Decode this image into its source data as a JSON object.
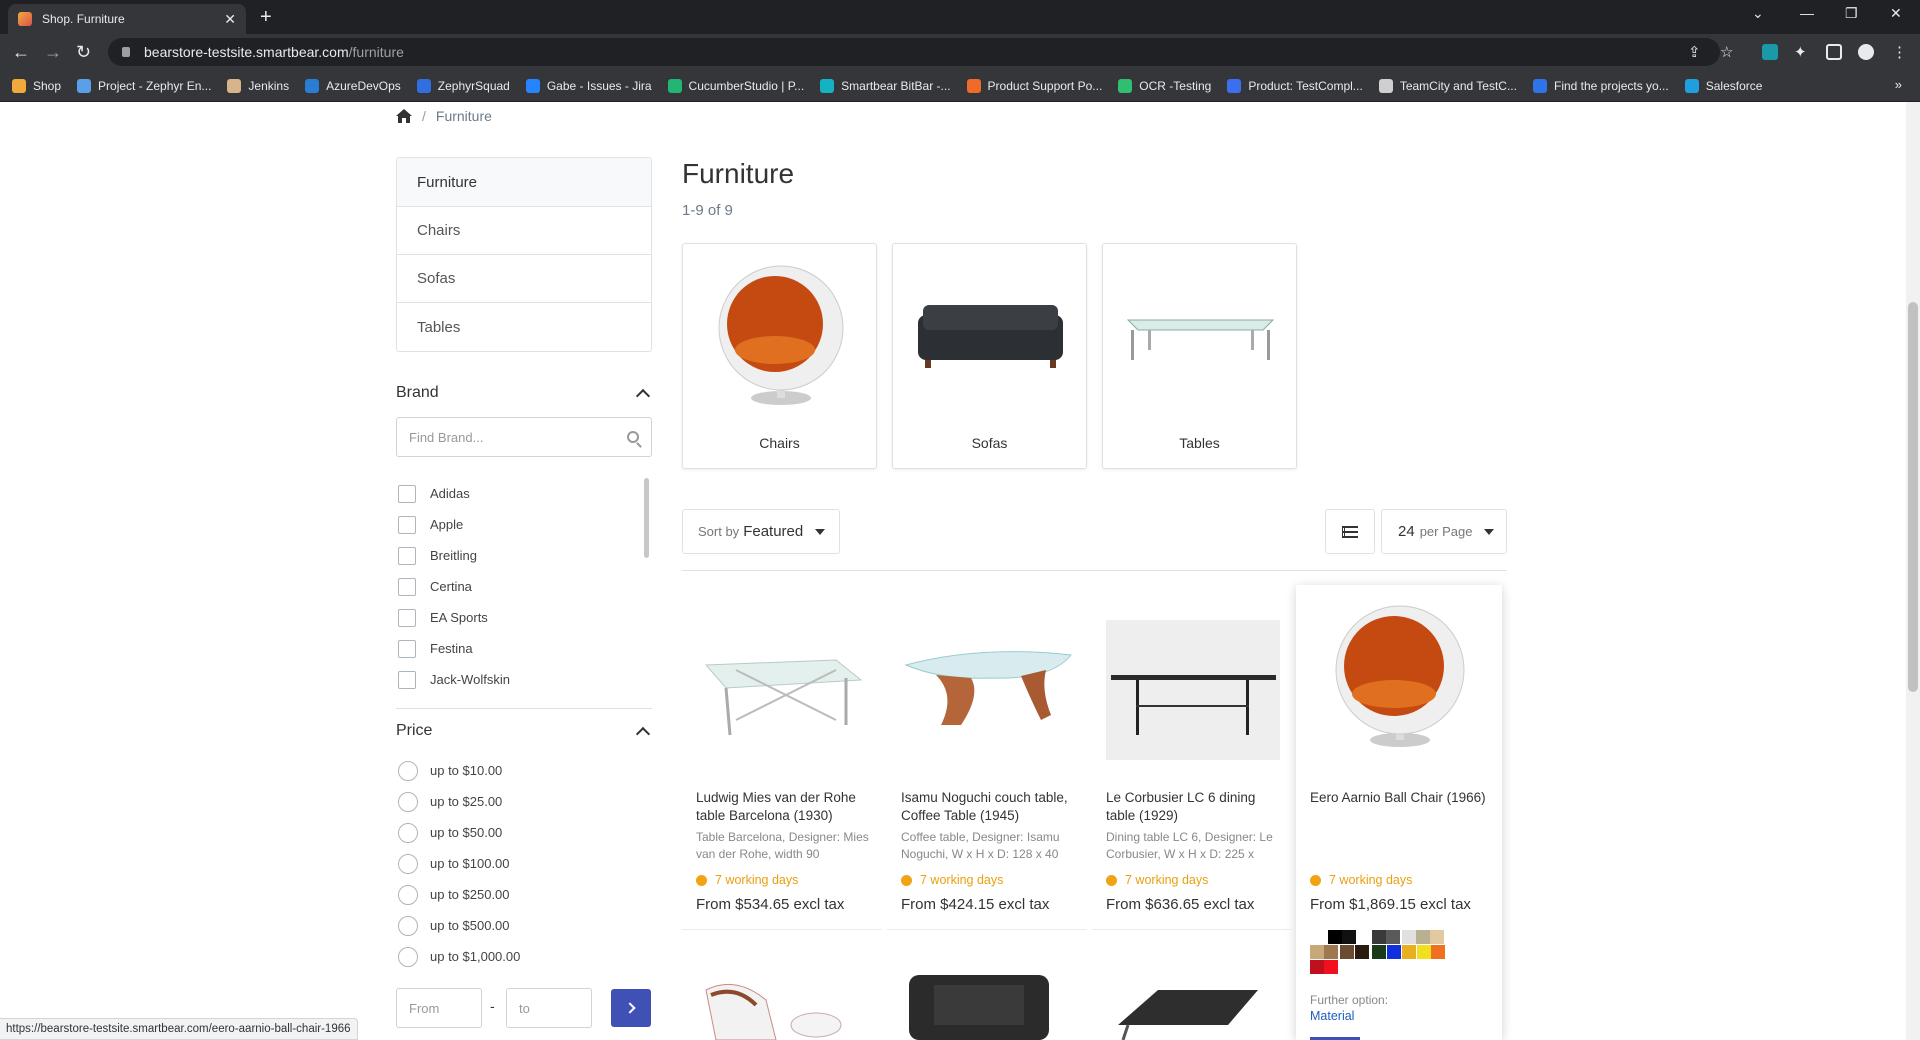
{
  "browser": {
    "tab_title": "Shop. Furniture",
    "url_host": "bearstore-testsite.smartbear.com",
    "url_path": "/furniture",
    "bookmarks": [
      {
        "label": "Shop",
        "color": "#f2a93b"
      },
      {
        "label": "Project - Zephyr En...",
        "color": "#5aa0e8"
      },
      {
        "label": "Jenkins",
        "color": "#d8b48a"
      },
      {
        "label": "AzureDevOps",
        "color": "#2b7cd3"
      },
      {
        "label": "ZephyrSquad",
        "color": "#2f6fdf"
      },
      {
        "label": "Gabe - Issues - Jira",
        "color": "#2684ff"
      },
      {
        "label": "CucumberStudio | P...",
        "color": "#22b573"
      },
      {
        "label": "Smartbear BitBar -...",
        "color": "#14b3c4"
      },
      {
        "label": "Product Support Po...",
        "color": "#f06a2a"
      },
      {
        "label": "OCR -Testing",
        "color": "#2fbf71"
      },
      {
        "label": "Product: TestCompl...",
        "color": "#3b6ff0"
      },
      {
        "label": "TeamCity and TestC...",
        "color": "#cfcfcf"
      },
      {
        "label": "Find the projects yo...",
        "color": "#2e74e8"
      },
      {
        "label": "Salesforce",
        "color": "#1f9ee0"
      }
    ],
    "bookmarks_more": "»",
    "status_url": "https://bearstore-testsite.smartbear.com/eero-aarnio-ball-chair-1966"
  },
  "breadcrumb": {
    "current": "Furniture",
    "separator": "/"
  },
  "sidebar": {
    "categories": [
      "Furniture",
      "Chairs",
      "Sofas",
      "Tables"
    ],
    "brand": {
      "title": "Brand",
      "search_placeholder": "Find Brand...",
      "options": [
        "Adidas",
        "Apple",
        "Breitling",
        "Certina",
        "EA Sports",
        "Festina",
        "Jack-Wolfskin"
      ]
    },
    "price": {
      "title": "Price",
      "options": [
        "up to $10.00",
        "up to $25.00",
        "up to $50.00",
        "up to $100.00",
        "up to $250.00",
        "up to $500.00",
        "up to $1,000.00"
      ],
      "from_placeholder": "From",
      "to_placeholder": "to",
      "dash": "-"
    }
  },
  "main": {
    "title": "Furniture",
    "count": "1-9 of 9",
    "subcategories": [
      "Chairs",
      "Sofas",
      "Tables"
    ],
    "sort": {
      "prefix": "Sort by",
      "value": "Featured"
    },
    "per_page": {
      "number": "24",
      "label": "per Page"
    },
    "products": [
      {
        "name": "Ludwig Mies van der Rohe table Barcelona (1930)",
        "desc": "Table Barcelona, Designer: Mies van der Rohe, width 90",
        "delivery": "7 working days",
        "price": "From $534.65 excl tax"
      },
      {
        "name": "Isamu Noguchi couch table, Coffee Table (1945)",
        "desc": "Coffee table, Designer: Isamu Noguchi, W x H x D: 128 x 40",
        "delivery": "7 working days",
        "price": "From $424.15 excl tax"
      },
      {
        "name": "Le Corbusier LC 6 dining table (1929)",
        "desc": "Dining table LC 6, Designer: Le Corbusier, W x H x D: 225 x",
        "delivery": "7 working days",
        "price": "From $636.65 excl tax"
      },
      {
        "name": "Eero Aarnio Ball Chair (1966)",
        "desc": "",
        "delivery": "7 working days",
        "price": "From $1,869.15 excl tax",
        "further_label": "Further option:",
        "further_link": "Material"
      }
    ],
    "swatch_colors": [
      "#000000",
      "#111111",
      "#ffffff",
      "#3a3a3a",
      "#5a5a5a",
      "#e0e0e0",
      "#b8b090",
      "#e2c9a0",
      "#c8a878",
      "#a07850",
      "#6a4a30",
      "#2a1a10",
      "#1a3a1a",
      "#1030e0",
      "#e8b020",
      "#f0e020",
      "#f07020",
      "#c01020",
      "#f01020"
    ]
  }
}
